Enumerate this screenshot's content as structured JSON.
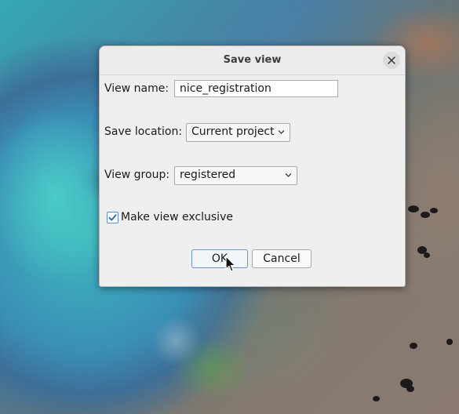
{
  "dialog": {
    "title": "Save view",
    "close_icon": "close-icon",
    "view_name": {
      "label": "View name:",
      "value": "nice_registration"
    },
    "save_location": {
      "label": "Save location:",
      "selected": "Current project"
    },
    "view_group": {
      "label": "View group:",
      "selected": "registered"
    },
    "exclusive": {
      "label": "Make view exclusive",
      "checked": true
    },
    "buttons": {
      "ok": "OK",
      "cancel": "Cancel"
    }
  },
  "colors": {
    "focus_accent": "#5c8fc5",
    "checkbox_check": "#2f6ab0",
    "dialog_background": "#efefef"
  }
}
